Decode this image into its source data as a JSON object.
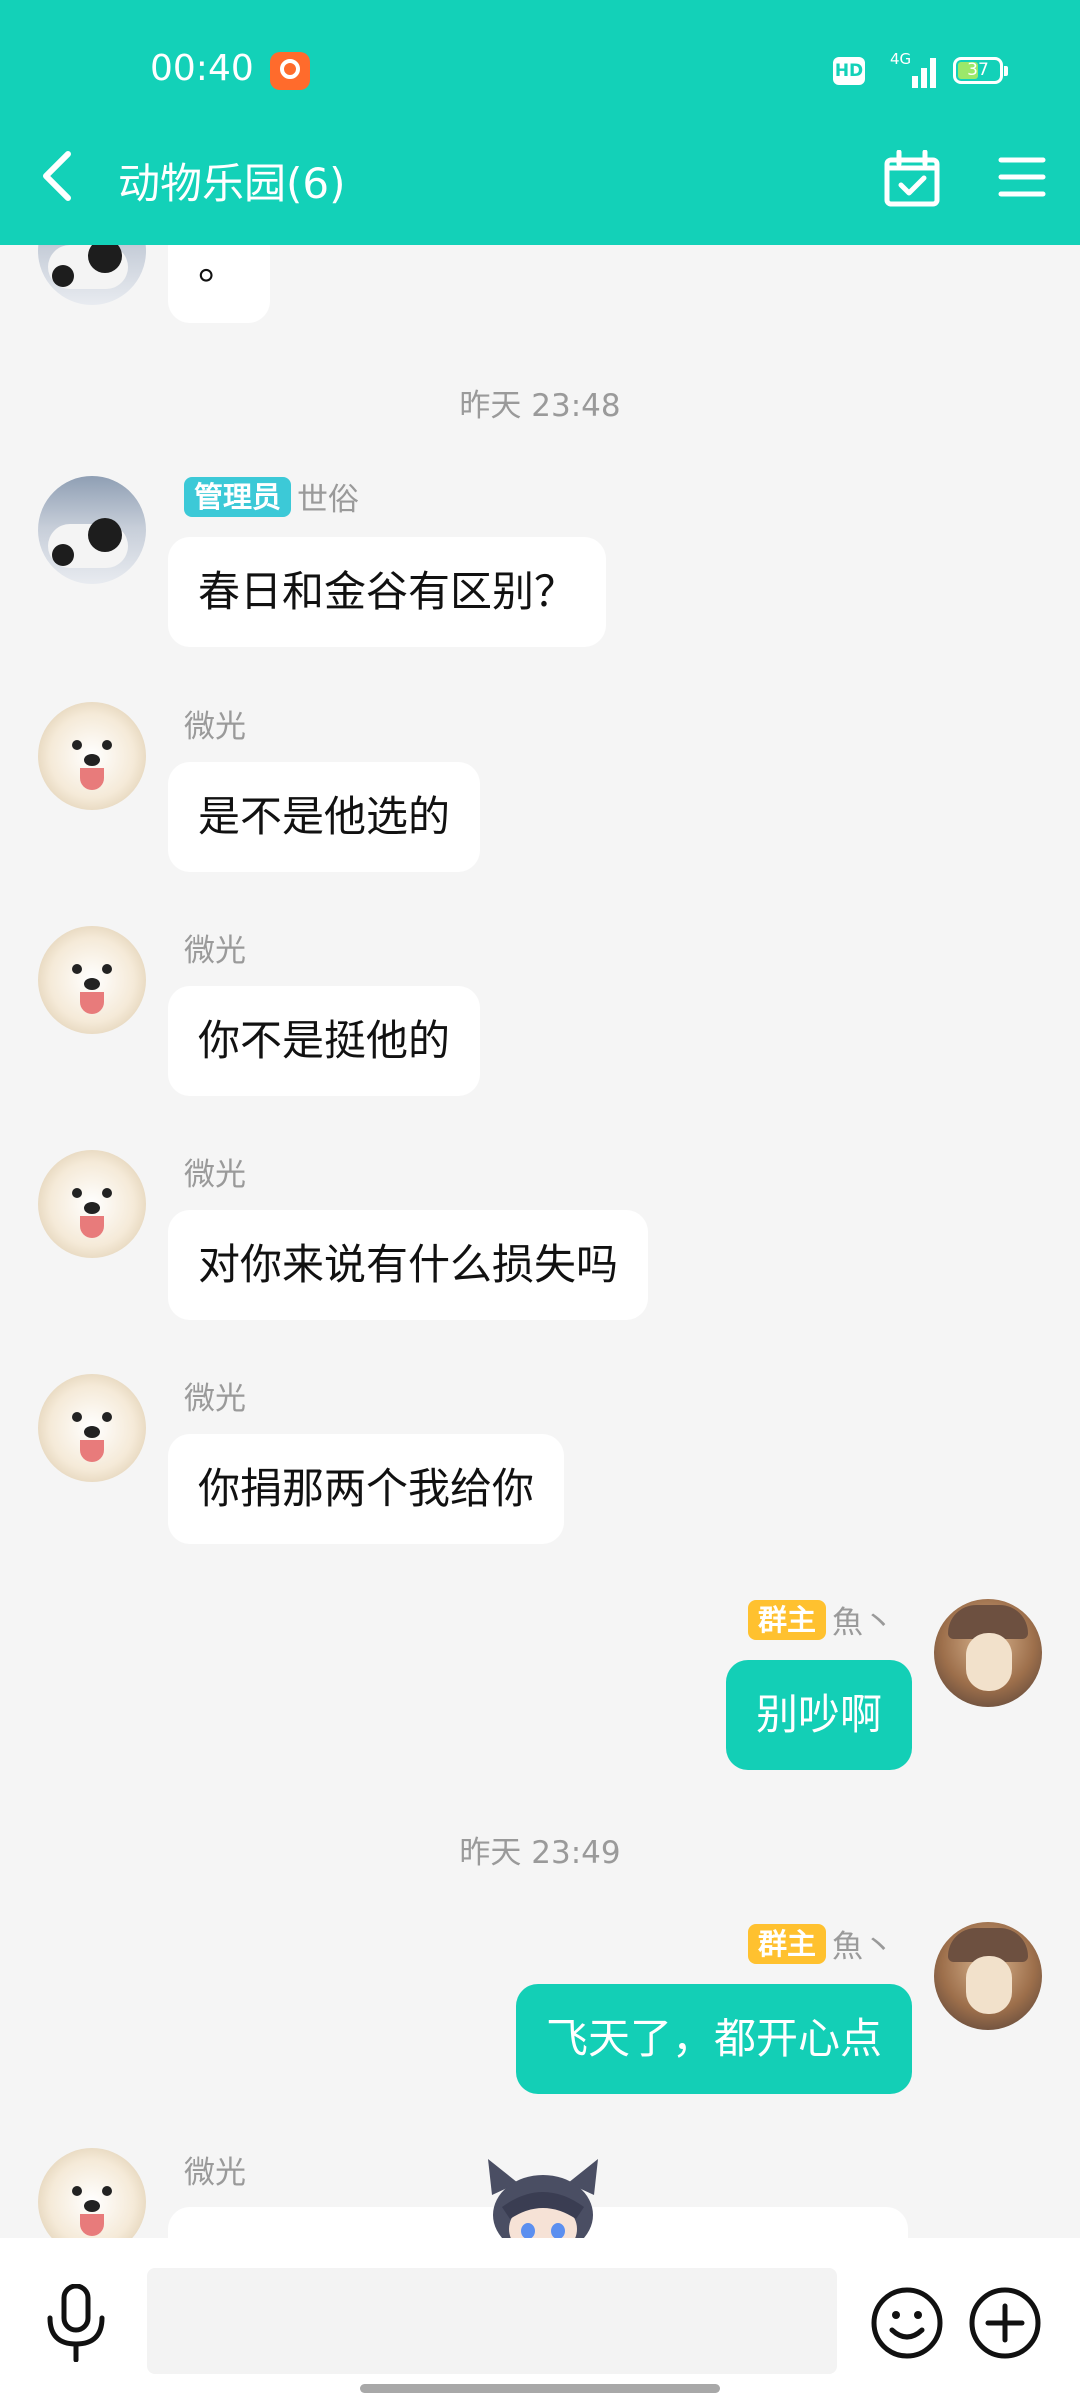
{
  "status_bar": {
    "time": "00:40",
    "hd": "HD",
    "network": "4G",
    "battery": "37"
  },
  "header": {
    "title": "动物乐园(6)",
    "back_icon": "chevron-left-icon",
    "calendar_icon": "calendar-check-icon",
    "menu_icon": "hamburger-menu-icon"
  },
  "colors": {
    "accent": "#13d1b8",
    "admin_badge": "#3cc9d7",
    "owner_badge": "#ffc12f",
    "background": "#f5f5f5"
  },
  "messages": {
    "partial_top": {
      "text": "。"
    },
    "timestamp1": "昨天 23:48",
    "m1": {
      "badge": "管理员",
      "sender": "世俗",
      "text": "春日和金谷有区别？"
    },
    "m2": {
      "sender": "微光",
      "text": "是不是他选的"
    },
    "m3": {
      "sender": "微光",
      "text": "你不是挺他的"
    },
    "m4": {
      "sender": "微光",
      "text": "对你来说有什么损失吗"
    },
    "m5": {
      "sender": "微光",
      "text": "你捐那两个我给你"
    },
    "m6": {
      "badge": "群主",
      "sender": "魚丶",
      "text": "别吵啊"
    },
    "timestamp2": "昨天 23:49",
    "m7": {
      "badge": "群主",
      "sender": "魚丶",
      "text": "飞天了，都开心点"
    },
    "m8": {
      "sender": "微光",
      "sticker": "anime-cat-ear-boy-sticker"
    }
  },
  "input_bar": {
    "placeholder": "",
    "mic_icon": "microphone-icon",
    "emoji_icon": "smiley-icon",
    "plus_icon": "plus-circle-icon"
  }
}
